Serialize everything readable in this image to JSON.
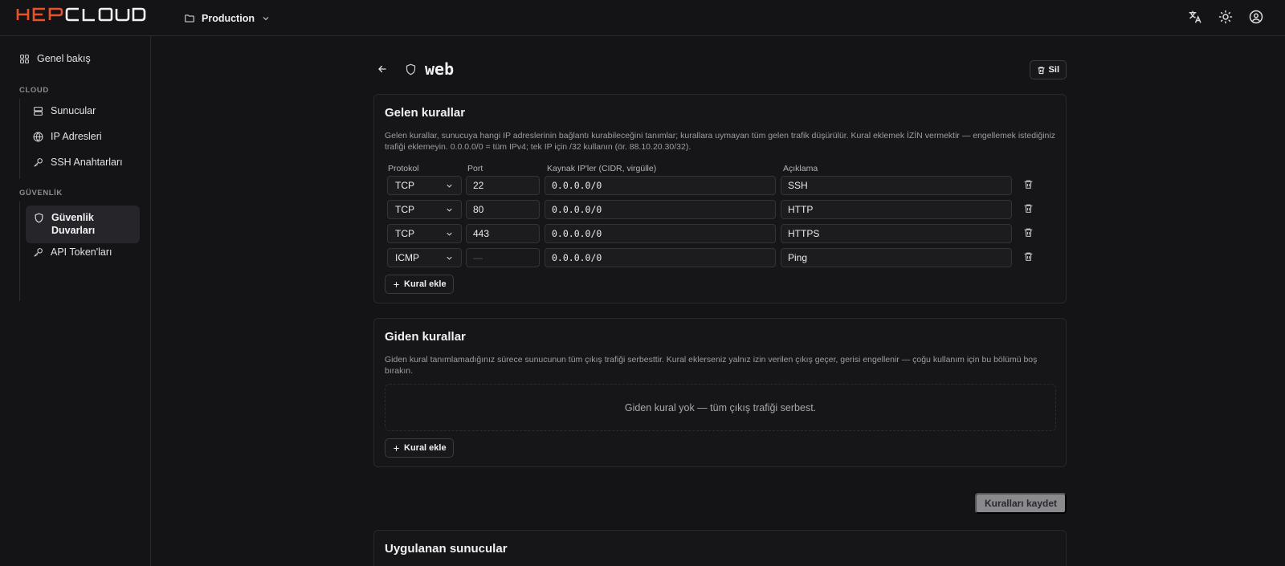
{
  "header": {
    "logo_text": "HEPCLOUD",
    "brand_color": "#e8512a",
    "project_label": "Production",
    "icons": [
      "translate-icon",
      "theme-toggle-icon",
      "user-account-icon"
    ]
  },
  "sidebar": {
    "overview": "Genel bakış",
    "cloud_section": "CLOUD",
    "cloud_items": [
      "Sunucular",
      "IP Adresleri",
      "SSH Anahtarları"
    ],
    "security_section": "GÜVENLİK",
    "security_active": "Güvenlik Duvarları",
    "security_items": [
      "API Token'ları"
    ]
  },
  "page": {
    "title": "web",
    "delete_label": "Sil",
    "save_label": "Kuralları kaydet"
  },
  "inbound": {
    "title": "Gelen kurallar",
    "description": "Gelen kurallar, sunucuya hangi IP adreslerinin bağlantı kurabileceğini tanımlar; kurallara uymayan tüm gelen trafik düşürülür. Kural eklemek İZİN vermektir — engellemek istediğiniz trafiği eklemeyin. 0.0.0.0/0 = tüm IPv4; tek IP için /32 kullanın (ör. 88.10.20.30/32).",
    "columns": {
      "protocol": "Protokol",
      "port": "Port",
      "source": "Kaynak IP'ler (CIDR, virgülle)",
      "description": "Açıklama"
    },
    "rules": [
      {
        "protocol": "TCP",
        "port": "22",
        "source": "0.0.0.0/0",
        "description": "SSH"
      },
      {
        "protocol": "TCP",
        "port": "80",
        "source": "0.0.0.0/0",
        "description": "HTTP"
      },
      {
        "protocol": "TCP",
        "port": "443",
        "source": "0.0.0.0/0",
        "description": "HTTPS"
      },
      {
        "protocol": "ICMP",
        "port": "—",
        "source": "0.0.0.0/0",
        "description": "Ping"
      }
    ],
    "add_label": "Kural ekle"
  },
  "outbound": {
    "title": "Giden kurallar",
    "description": "Giden kural tanımlamadığınız sürece sunucunun tüm çıkış trafiği serbesttir. Kural eklerseniz yalnız izin verilen çıkış geçer, gerisi engellenir — çoğu kullanım için bu bölümü boş bırakın.",
    "empty_text": "Giden kural yok — tüm çıkış trafiği serbest.",
    "add_label": "Kural ekle"
  },
  "applied": {
    "title": "Uygulanan sunucular"
  }
}
